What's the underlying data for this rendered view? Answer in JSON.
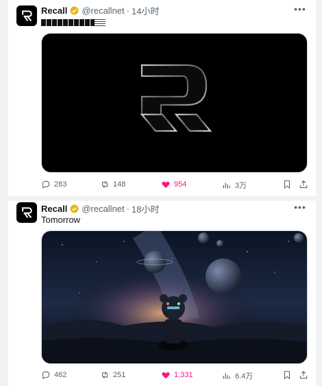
{
  "tweets": [
    {
      "author_name": "Recall",
      "handle": "@recallnet",
      "separator": "·",
      "time": "14小时",
      "text_redacted": true,
      "media_kind": "logo-r-dark",
      "stats": {
        "replies": "283",
        "reposts": "148",
        "likes": "954",
        "views": "3万"
      },
      "liked": true
    },
    {
      "author_name": "Recall",
      "handle": "@recallnet",
      "separator": "·",
      "time": "18小时",
      "text": "Tomorrow",
      "media_kind": "space-scene",
      "stats": {
        "replies": "462",
        "reposts": "251",
        "likes": "1,331",
        "views": "6.4万"
      },
      "liked": true
    }
  ],
  "icons": {
    "more": "more-dots-icon",
    "verified": "verified-badge-icon",
    "reply": "reply-icon",
    "repost": "repost-icon",
    "like": "heart-icon",
    "views": "views-bar-icon",
    "bookmark": "bookmark-icon",
    "share": "share-icon"
  },
  "colors": {
    "like_active": "#f91880",
    "muted": "#536471",
    "verified_gold": "#e2b719"
  }
}
